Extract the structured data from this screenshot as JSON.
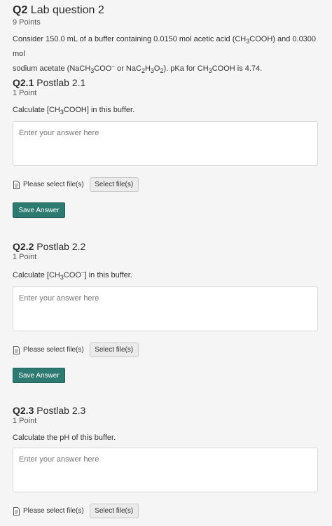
{
  "question": {
    "number": "Q2",
    "title": "Lab question 2",
    "points": "9 Points",
    "intro_line1_a": "Consider 150.0 mL of a buffer containing 0.0150 mol acetic acid (CH",
    "intro_line1_sub": "3",
    "intro_line1_b": "COOH) and 0.0300 mol",
    "intro_line2_a": "sodium acetate (NaCH",
    "intro_line2_sub1": "3",
    "intro_line2_b": "COO",
    "intro_line2_sup": "−",
    "intro_line2_c": " or NaC",
    "intro_line2_sub2": "2",
    "intro_line2_d": "H",
    "intro_line2_sub3": "3",
    "intro_line2_e": "O",
    "intro_line2_sub4": "2",
    "intro_line2_f": "). pKa for CH",
    "intro_line2_sub5": "3",
    "intro_line2_g": "COOH is 4.74."
  },
  "parts": [
    {
      "number": "Q2.1",
      "title": "Postlab 2.1",
      "points": "1 Point",
      "prompt_a": "Calculate [CH",
      "prompt_sub": "3",
      "prompt_b": "COOH] in this buffer.",
      "placeholder": "Enter your answer here",
      "file_label": "Please select file(s)",
      "select_label": "Select file(s)",
      "save_label": "Save Answer"
    },
    {
      "number": "Q2.2",
      "title": "Postlab 2.2",
      "points": "1 Point",
      "prompt_a": "Calculate [CH",
      "prompt_sub": "3",
      "prompt_b": "COO",
      "prompt_sup": "−",
      "prompt_c": "] in this buffer.",
      "placeholder": "Enter your answer here",
      "file_label": "Please select file(s)",
      "select_label": "Select file(s)",
      "save_label": "Save Answer"
    },
    {
      "number": "Q2.3",
      "title": "Postlab 2.3",
      "points": "1 Point",
      "prompt_a": "Calculate the pH of this buffer.",
      "placeholder": "Enter your answer here",
      "file_label": "Please select file(s)",
      "select_label": "Select file(s)"
    }
  ],
  "colors": {
    "save_button": "#2d7a72",
    "background": "#f5f5f5"
  },
  "icons": {
    "file": "file-icon"
  }
}
